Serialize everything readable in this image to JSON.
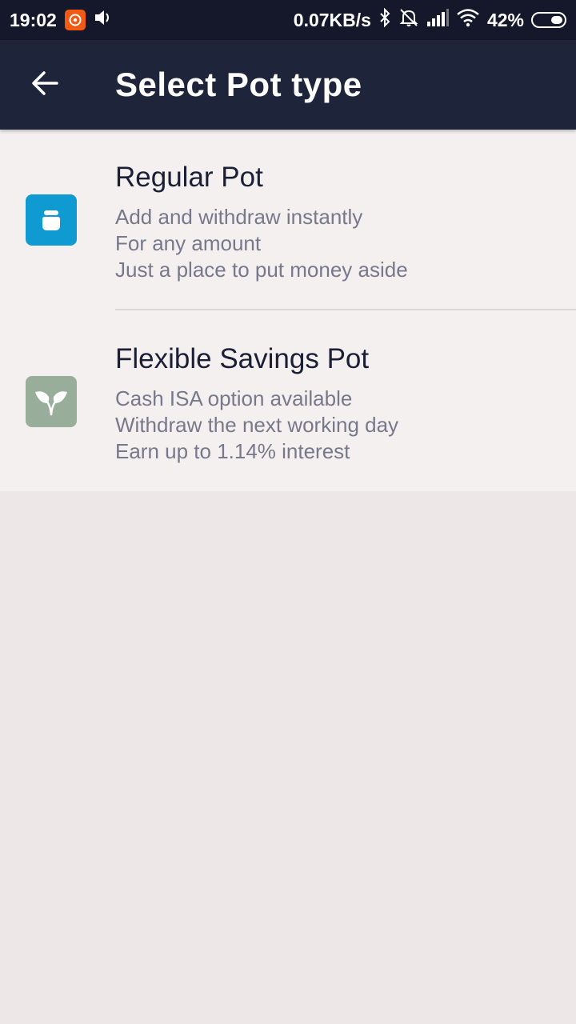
{
  "status_bar": {
    "time": "19:02",
    "network_speed": "0.07KB/s",
    "battery_percent": "42%",
    "battery_level": 0.42,
    "icons": [
      "app-notification-icon",
      "volume-icon",
      "bluetooth-icon",
      "alarm-off-icon",
      "signal-icon",
      "wifi-icon",
      "battery-icon"
    ]
  },
  "header": {
    "title": "Select Pot type",
    "back_icon": "arrow-left-icon"
  },
  "pots": [
    {
      "title": "Regular Pot",
      "icon": "jar-icon",
      "icon_color": "#0f9bd2",
      "lines": [
        "Add and withdraw instantly",
        "For any amount",
        "Just a place to put money aside"
      ]
    },
    {
      "title": "Flexible Savings Pot",
      "icon": "leaf-icon",
      "icon_color": "#99ad9b",
      "lines": [
        "Cash ISA option available",
        "Withdraw the next working day",
        "Earn up to 1.14% interest"
      ]
    }
  ],
  "colors": {
    "status_bar": "#14182a",
    "app_bar": "#1e2439",
    "list_background": "#f5f0f0",
    "page_background": "#ede7e7"
  }
}
